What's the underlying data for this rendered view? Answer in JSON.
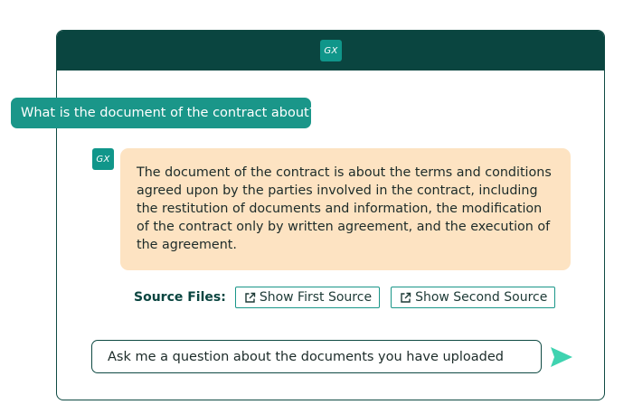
{
  "header": {
    "logo_text": "GX"
  },
  "user_message": "What is the document of the contract about?",
  "bot": {
    "logo_text": "GX",
    "message": "The document of the contract is about the terms and conditions agreed upon by the parties involved in the contract, including the restitution of documents and information, the modification of the contract only by written agreement, and the execution of the agreement."
  },
  "sources": {
    "label": "Source Files:",
    "first_label": "Show First Source",
    "second_label": "Show Second Source"
  },
  "input": {
    "placeholder": "Ask me a question about the documents you have uploaded"
  },
  "colors": {
    "header_bg": "#0a4540",
    "accent": "#1a9689",
    "bot_bubble": "#fde3c2",
    "send_icon": "#3fd3b0"
  },
  "icons": {
    "source_link": "external-link-icon",
    "send": "send-icon"
  }
}
